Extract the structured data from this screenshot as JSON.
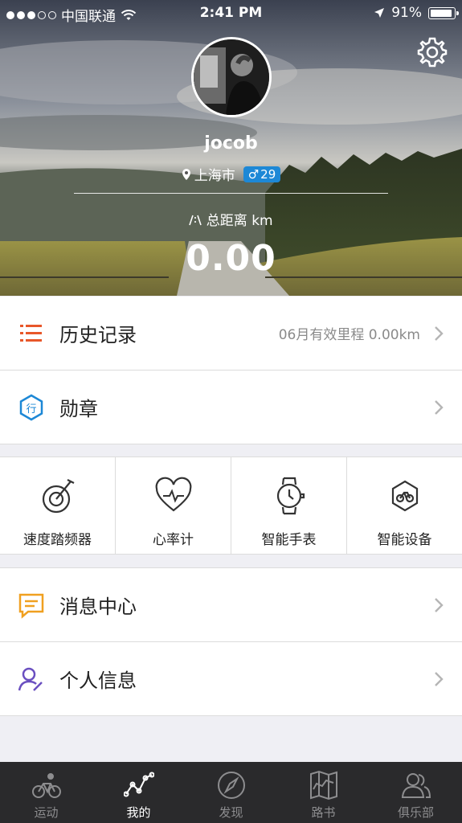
{
  "status_bar": {
    "carrier": "中国联通",
    "time": "2:41 PM",
    "battery": "91%",
    "signal_dots_filled": 3,
    "signal_dots_total": 5
  },
  "profile": {
    "username": "jocob",
    "city": "上海市",
    "gender_symbol": "♂",
    "age": "29",
    "total_distance_label": "总距离 km",
    "total_distance_value": "0.00",
    "settings_icon": "gear-icon"
  },
  "menu_top": [
    {
      "label": "历史记录",
      "extra": "06月有效里程 0.00km",
      "icon": "history-list-icon",
      "color": "#e8572a"
    },
    {
      "label": "勋章",
      "extra": "",
      "icon": "medal-hexagon-icon",
      "color": "#1d88d6"
    }
  ],
  "devices": [
    {
      "label": "速度踏频器",
      "icon": "speed-cadence-sensor-icon"
    },
    {
      "label": "心率计",
      "icon": "heart-rate-icon"
    },
    {
      "label": "智能手表",
      "icon": "smartwatch-icon"
    },
    {
      "label": "智能设备",
      "icon": "smart-device-icon"
    }
  ],
  "menu_bottom": [
    {
      "label": "消息中心",
      "icon": "message-icon",
      "color": "#f0a020"
    },
    {
      "label": "个人信息",
      "icon": "user-edit-icon",
      "color": "#6a4fc0"
    }
  ],
  "tabs": [
    {
      "label": "运动",
      "icon": "bike-icon",
      "active": false
    },
    {
      "label": "我的",
      "icon": "chart-line-icon",
      "active": true
    },
    {
      "label": "发现",
      "icon": "compass-icon",
      "active": false
    },
    {
      "label": "路书",
      "icon": "map-icon",
      "active": false
    },
    {
      "label": "俱乐部",
      "icon": "group-icon",
      "active": false
    }
  ],
  "colors": {
    "accent_blue": "#1d88d6",
    "tabbar_bg": "#2a2a2c",
    "page_bg": "#efeff4"
  }
}
